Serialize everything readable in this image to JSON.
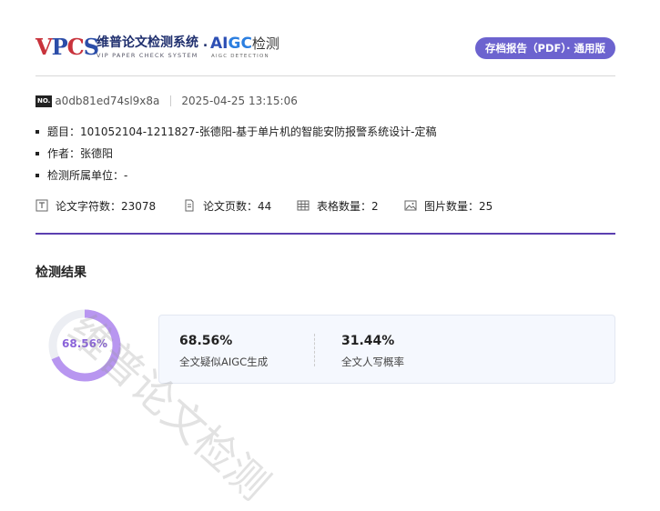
{
  "header": {
    "logo_vpcs": "VPCS",
    "logo_cn": "维普论文检测系统 .",
    "logo_en": "VIP PAPER CHECK SYSTEM",
    "logo_aigc": "AIGC",
    "logo_aigc_cn": "检测",
    "logo_aigc_en": "AIGC DETECTION",
    "badge": "存档报告（PDF）· 通用版"
  },
  "meta": {
    "no_label": "NO.",
    "doc_id": "a0db81ed74sl9x8a",
    "datetime": "2025-04-25 13:15:06"
  },
  "info": {
    "title_label": "题目：",
    "title_value": "101052104-1211827-张德阳-基于单片机的智能安防报警系统设计-定稿",
    "author_label": "作者：",
    "author_value": "张德阳",
    "unit_label": "检测所属单位：",
    "unit_value": "-"
  },
  "stats": {
    "chars_label": "论文字符数：",
    "chars_value": "23078",
    "pages_label": "论文页数：",
    "pages_value": "44",
    "tables_label": "表格数量：",
    "tables_value": "2",
    "images_label": "图片数量：",
    "images_value": "25"
  },
  "results": {
    "section_title": "检测结果",
    "ring_value": 0.6856,
    "ring_label": "68.56%",
    "ring_color": "#b896f0",
    "aigc_value": "68.56%",
    "aigc_label": "全文疑似AIGC生成",
    "human_value": "31.44%",
    "human_label": "全文人写概率"
  },
  "watermark": "维普论文检测",
  "colors": {
    "accent": "#6c63cf",
    "divider": "#5b3fb0"
  }
}
